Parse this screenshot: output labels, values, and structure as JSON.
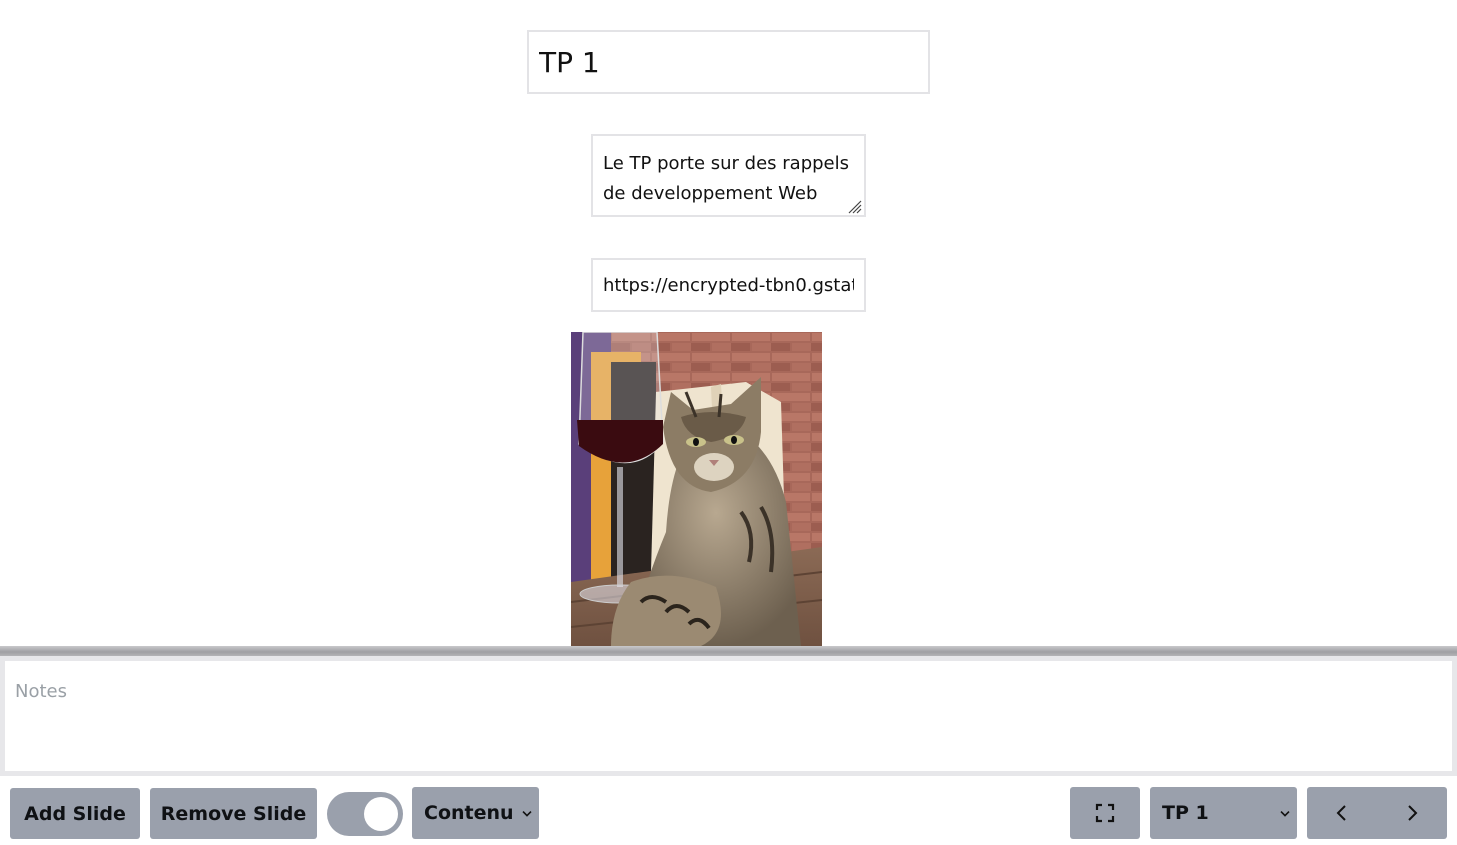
{
  "slide": {
    "title_value": "TP 1",
    "description_value": "Le TP porte sur des rappels de developpement Web",
    "image_url_value": "https://encrypted-tbn0.gstat",
    "image_alt": "cat with wine glass"
  },
  "notes": {
    "placeholder": "Notes",
    "value": ""
  },
  "toolbar": {
    "add_label": "Add Slide",
    "remove_label": "Remove Slide",
    "toggle_on": true,
    "mode_select_value": "Contenu",
    "slide_select_value": "TP 1"
  },
  "icons": {
    "fullscreen": "fullscreen-icon",
    "prev": "chevron-left-icon",
    "next": "chevron-right-icon",
    "dropdown": "chevron-down-icon"
  },
  "colors": {
    "button_bg": "#9aa0ac",
    "border": "#e3e3e6",
    "notes_bg": "#e7e7ea"
  }
}
